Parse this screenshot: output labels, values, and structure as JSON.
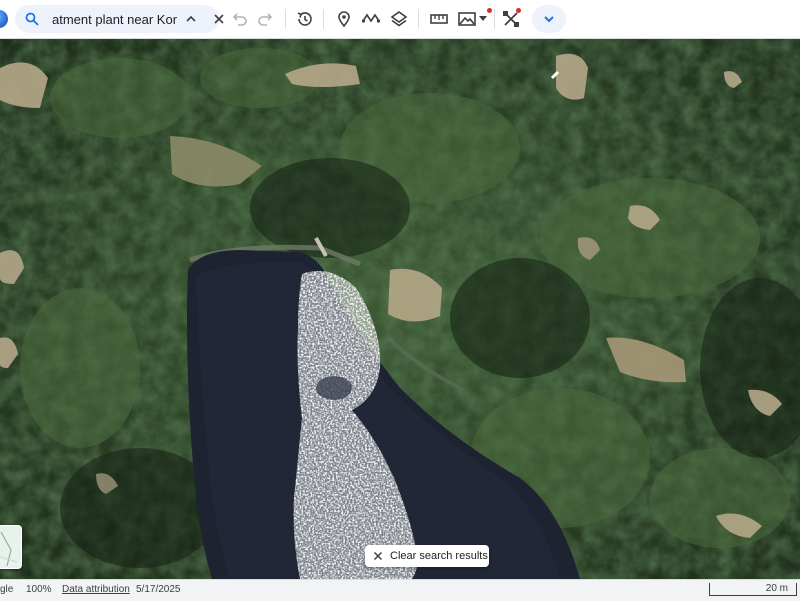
{
  "search": {
    "value": "atment plant near Kor"
  },
  "toolbar": {
    "buttons": [
      {
        "name": "undo",
        "icon": "undo-icon",
        "enabled": false
      },
      {
        "name": "redo",
        "icon": "redo-icon",
        "enabled": false
      },
      {
        "name": "historical-imagery",
        "icon": "history-icon"
      },
      {
        "name": "add-placemark",
        "icon": "placemark-icon"
      },
      {
        "name": "add-path",
        "icon": "path-icon"
      },
      {
        "name": "layers",
        "icon": "layers-icon"
      },
      {
        "name": "measure",
        "icon": "ruler-icon"
      },
      {
        "name": "map-style",
        "icon": "mountain-icon"
      },
      {
        "name": "tools",
        "icon": "tools-icon"
      },
      {
        "name": "expand",
        "icon": "chevron-down-icon"
      }
    ],
    "accent_color": "#1a73e8",
    "notification_color": "#d93025"
  },
  "chip": {
    "label": "Clear search results"
  },
  "status": {
    "brand_fragment": "gle",
    "zoom": "100%",
    "attribution": "Data attribution",
    "date": "5/17/2025",
    "scale": "20 m"
  }
}
